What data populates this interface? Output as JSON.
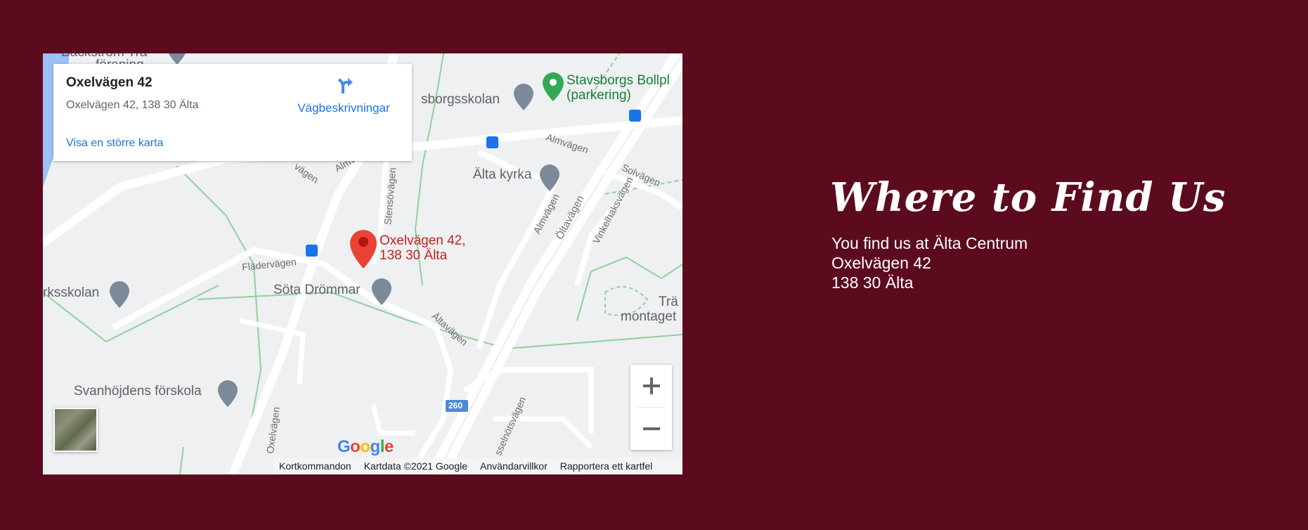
{
  "map": {
    "card": {
      "title": "Oxelvägen 42",
      "address": "Oxelvägen 42, 138 30 Älta",
      "larger_map": "Visa en större karta",
      "directions": "Vägbeskrivningar"
    },
    "places": {
      "backstrom_1": "Bäckström Trä",
      "backstrom_2": "förening",
      "skolan": "sborgsskolan",
      "bollplan_1": "Stavsborgs Bollpl",
      "bollplan_2": "(parkering)",
      "kyrka": "Älta kyrka",
      "marker_1": "Oxelvägen 42,",
      "marker_2": "138 30 Älta",
      "rksskolan": "rksskolan",
      "sota": "Söta Drömmar",
      "forskola": "Svanhöjdens förskola",
      "tra_1": "Trä",
      "tra_2": "montaget"
    },
    "streets": {
      "almvagen_top": "Almvägen",
      "almv_left": "Almv",
      "vagen_left": "vägen",
      "stensovagen": "Stensövägen",
      "solvagen": "Solvägen",
      "almvagen_diag": "Almvägen",
      "altavagen": "Öltavägen",
      "vinkelhaksvagen": "Vinkelhaksvägen",
      "fladervagen": "Flädervägen",
      "altavagen_low": "Ältavägen",
      "oxelvagen": "Oxelvägen",
      "route": "260",
      "sselnotsvagen": "sselnötsvägen"
    },
    "footer": {
      "shortcuts": "Kortkommandon",
      "map_data": "Kartdata ©2021 Google",
      "terms": "Användarvillkor",
      "report": "Rapportera ett kartfel"
    },
    "logo": "Google",
    "zoom_in": "+",
    "zoom_out": "−"
  },
  "heading": "Where to Find Us",
  "address_lines": {
    "line1": "You find us at Älta Centrum",
    "line2": "Oxelvägen 42",
    "line3": "138 30 Älta"
  },
  "colors": {
    "background": "#5c0b1e",
    "link": "#1a73e8",
    "marker": "#ea4335"
  }
}
